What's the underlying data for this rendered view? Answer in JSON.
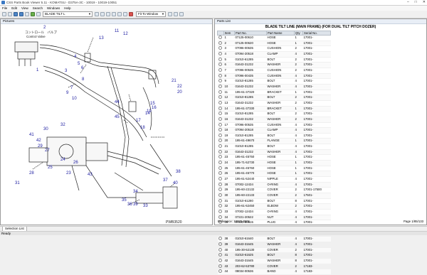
{
  "window": {
    "title": "CSS Parts Book Viewer 5.11 - KOMATSU - D375A-3C - 10019 - 10019-10051",
    "controls": [
      "–",
      "□",
      "✕"
    ]
  },
  "menu": [
    "File",
    "Edit",
    "View",
    "Search",
    "Windows",
    "Help"
  ],
  "toolbar": {
    "section_select": "BLADE TILT L",
    "zoom_select": "Fit To Window"
  },
  "left_panel": {
    "header": "Pictures",
    "drawing_label": "PWB3520",
    "control_valve_jp": "コントロール　バルブ",
    "control_valve_en": "Control Valve",
    "callouts": [
      "1",
      "2",
      "3",
      "4",
      "5",
      "6",
      "7",
      "8",
      "9",
      "10",
      "11",
      "12",
      "13",
      "14",
      "15",
      "16",
      "17",
      "18",
      "19",
      "20",
      "21",
      "22",
      "23",
      "24",
      "25",
      "26",
      "27",
      "28",
      "29",
      "30",
      "31",
      "32",
      "33",
      "34",
      "35",
      "36",
      "37",
      "38",
      "39",
      "40",
      "41",
      "42",
      "43",
      "44",
      "45"
    ]
  },
  "right_panel": {
    "header": "Parts List",
    "title": "BLADE TILT LINE (MAIN FRAME) (FOR DUAL TILT PITCH DOZER)",
    "columns": [
      "",
      "Item",
      "Part No.",
      "Part Name",
      "Qty",
      "Serial No."
    ],
    "rows": [
      [
        "1",
        "07125-00610",
        "HOSE",
        "1",
        "17001-"
      ],
      [
        "2",
        "07125-00620",
        "HOSE",
        "1",
        "17001-"
      ],
      [
        "3",
        "07096-00635",
        "CUSHION",
        "2",
        "17001-"
      ],
      [
        "4",
        "07094-20518",
        "CLAMP",
        "4",
        "17001-"
      ],
      [
        "5",
        "01010-61285",
        "BOLT",
        "2",
        "17001-"
      ],
      [
        "6",
        "01643-31232",
        "WASHER",
        "2",
        "17001-"
      ],
      [
        "7",
        "07096-00535",
        "CUSHION",
        "2",
        "17001-"
      ],
      [
        "8",
        "07096-00435",
        "CUSHION",
        "4",
        "17001-"
      ],
      [
        "9",
        "01010-81285",
        "BOLT",
        "4",
        "17001-"
      ],
      [
        "10",
        "01643-31232",
        "WASHER",
        "4",
        "17001-"
      ],
      [
        "11",
        "195-61-37320",
        "BRACKET",
        "1",
        "17001-"
      ],
      [
        "12",
        "01010-81285",
        "BOLT",
        "2",
        "17001-"
      ],
      [
        "13",
        "01643-31232",
        "WASHER",
        "2",
        "17001-"
      ],
      [
        "14",
        "195-61-37330",
        "BRACKET",
        "1",
        "17001-"
      ],
      [
        "15",
        "01010-81285",
        "BOLT",
        "2",
        "17001-"
      ],
      [
        "16",
        "01643-31232",
        "WASHER",
        "2",
        "17001-"
      ],
      [
        "17",
        "07096-00535",
        "CUSHION",
        "4",
        "17001-"
      ],
      [
        "18",
        "07094-20518",
        "CLAMP",
        "4",
        "17001-"
      ],
      [
        "19",
        "01010-81285",
        "BOLT",
        "4",
        "17001-"
      ],
      [
        "20",
        "195-61-49670",
        "FLANGE",
        "1",
        "17001-"
      ],
      [
        "21",
        "01010-81285",
        "BOLT",
        "4",
        "17001-"
      ],
      [
        "22",
        "01643-31232",
        "WASHER",
        "4",
        "17001-"
      ],
      [
        "23",
        "195-61-45750",
        "HOSE",
        "1",
        "17001-"
      ],
      [
        "24",
        "195-71-52730",
        "HOSE",
        "1",
        "17001-"
      ],
      [
        "25",
        "195-61-45760",
        "HOSE",
        "1",
        "17001-"
      ],
      [
        "26",
        "195-61-45770",
        "HOSE",
        "1",
        "17001-"
      ],
      [
        "27",
        "195-61-52440",
        "NIPPLE",
        "4",
        "17001-"
      ],
      [
        "28",
        "07002-12434",
        "O-RING",
        "4",
        "17001-"
      ],
      [
        "29",
        "195-60-22132",
        "COVER",
        "2",
        "17001-17500"
      ],
      [
        "30",
        "195-60-22133",
        "COVER",
        "2",
        "17501-"
      ],
      [
        "31",
        "01010-61280",
        "BOLT",
        "8",
        "17001-"
      ],
      [
        "32",
        "195-61-52450",
        "ELBOW",
        "2",
        "17001-"
      ],
      [
        "33",
        "07002-12434",
        "O-RING",
        "4",
        "17001-"
      ],
      [
        "34",
        "07221-20522",
        "NUT",
        "4",
        "17001-"
      ],
      [
        "35",
        "07222-00515",
        "PLUG",
        "4",
        "17001-"
      ],
      [
        "36",
        "01010-81085",
        "BOLT",
        "14",
        "17001-"
      ],
      [
        "37",
        "01643-31645",
        "WASHER",
        "14",
        "17001-"
      ],
      [
        "38",
        "01010-61640",
        "BOLT",
        "4",
        "17001-"
      ],
      [
        "39",
        "01643-31645",
        "WASHER",
        "4",
        "17001-"
      ],
      [
        "40",
        "195-30-52130",
        "COVER",
        "2",
        "17001-"
      ],
      [
        "41",
        "01010-61625",
        "BOLT",
        "8",
        "17001-"
      ],
      [
        "42",
        "01643-31645",
        "WASHER",
        "8",
        "17001-"
      ],
      [
        "43",
        "203-62-53780",
        "COVER",
        "2",
        "17183-"
      ],
      [
        "44",
        "08034-00536",
        "BAND",
        "4",
        "17183-"
      ]
    ],
    "reference": "Reference: 10325-0201",
    "page": "Page 1/85/133"
  },
  "bottom_tab": "Selection List",
  "status": "Ready"
}
